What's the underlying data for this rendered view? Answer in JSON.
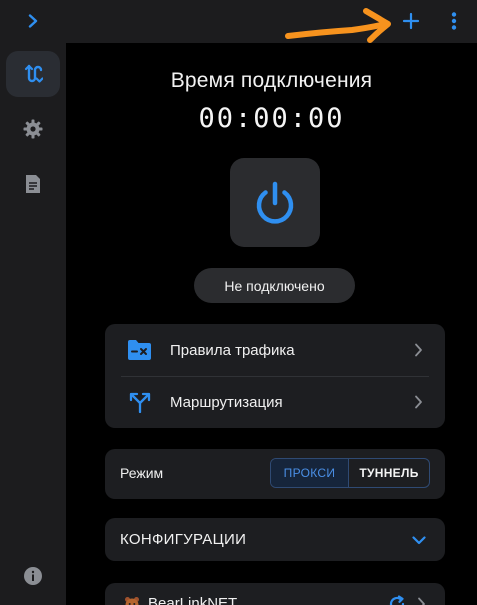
{
  "colors": {
    "accent": "#2f8ff0",
    "background": "#000000",
    "panel": "#1c1c1e",
    "card": "#1d1e21",
    "annotation": "#f7931e"
  },
  "topbar": {
    "expand_icon": "chevron-right-icon",
    "add_icon": "plus-icon",
    "more_icon": "more-vertical-icon"
  },
  "sidebar": {
    "items": [
      {
        "icon": "routes-icon",
        "active": true
      },
      {
        "icon": "gear-icon",
        "active": false
      },
      {
        "icon": "document-icon",
        "active": false
      }
    ],
    "info_icon": "info-icon"
  },
  "connection": {
    "title": "Время подключения",
    "timer": "00:00:00",
    "power_icon": "power-icon",
    "status": "Не подключено"
  },
  "menu": {
    "items": [
      {
        "label": "Правила трафика",
        "icon": "folder-x-icon"
      },
      {
        "label": "Маршрутизация",
        "icon": "route-split-icon"
      }
    ]
  },
  "mode": {
    "label": "Режим",
    "options": [
      "ПРОКСИ",
      "ТУННЕЛЬ"
    ],
    "selected": "ПРОКСИ"
  },
  "configs": {
    "label": "КОНФИГУРАЦИИ",
    "expand_icon": "chevron-down-icon"
  },
  "profile": {
    "name": "BearLinkNET",
    "icon": "profile-icon",
    "refresh_icon": "refresh-icon"
  }
}
